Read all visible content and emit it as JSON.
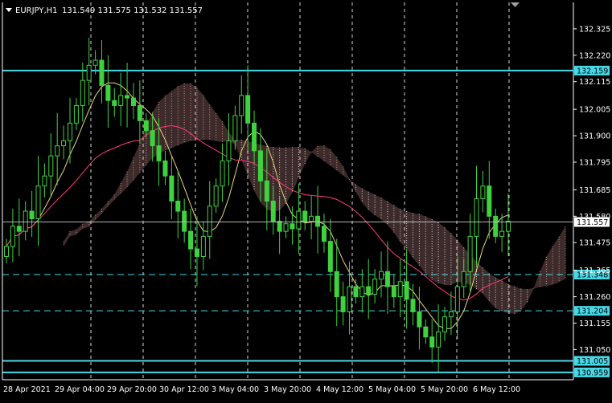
{
  "header": {
    "symbol": "EURJPY,H1",
    "ohlc": "131.549 131.575 131.532 131.557"
  },
  "colors": {
    "background": "#000000",
    "grid": "#ffffff",
    "candle": "#3fd23f",
    "hline": "#47d9e8",
    "ma_pink": "#ff3c78",
    "ma_yellow": "#e8d87a",
    "cloud_pink": "#f4a7a7",
    "cloud_white": "#ffffff",
    "axis_text": "#ffffff",
    "current_price_box": "#ffffff"
  },
  "chart_data": {
    "type": "candlestick",
    "title": "EURJPY,H1",
    "ylim": [
      130.93,
      132.43
    ],
    "y_ticks": [
      "132.325",
      "132.220",
      "132.115",
      "132.005",
      "131.900",
      "131.795",
      "131.685",
      "131.580",
      "131.475",
      "131.365",
      "131.260",
      "131.155",
      "131.050"
    ],
    "x_ticks": [
      "28 Apr 2021",
      "29 Apr 04:00",
      "29 Apr 20:00",
      "30 Apr 12:00",
      "3 May 04:00",
      "3 May 20:00",
      "4 May 12:00",
      "5 May 04:00",
      "5 May 20:00",
      "6 May 12:00"
    ],
    "current_price": "131.557",
    "horizontal_levels": [
      {
        "label": "132.159",
        "value": 132.159,
        "style": "solid"
      },
      {
        "label": "131.348",
        "value": 131.348,
        "style": "dashed"
      },
      {
        "label": "131.204",
        "value": 131.204,
        "style": "dashed"
      },
      {
        "label": "131.005",
        "value": 131.005,
        "style": "solid"
      },
      {
        "label": "130.959",
        "value": 130.959,
        "style": "solid"
      }
    ],
    "series": [
      {
        "name": "close",
        "values": [
          131.46,
          131.54,
          131.52,
          131.6,
          131.57,
          131.7,
          131.74,
          131.82,
          131.86,
          131.88,
          131.95,
          132.02,
          132.12,
          132.18,
          132.2,
          132.1,
          132.04,
          132.02,
          132.06,
          132.05,
          132.02,
          131.96,
          131.92,
          131.86,
          131.8,
          131.74,
          131.64,
          131.6,
          131.52,
          131.45,
          131.42,
          131.5,
          131.62,
          131.7,
          131.8,
          131.88,
          131.98,
          132.06,
          131.95,
          131.84,
          131.72,
          131.64,
          131.56,
          131.52,
          131.55,
          131.53,
          131.6,
          131.56,
          131.58,
          131.54,
          131.48,
          131.36,
          131.26,
          131.2,
          131.3,
          131.26,
          131.3,
          131.27,
          131.33,
          131.36,
          131.3,
          131.26,
          131.32,
          131.25,
          131.2,
          131.14,
          131.1,
          131.06,
          131.12,
          131.18,
          131.2,
          131.3,
          131.36,
          131.5,
          131.65,
          131.7,
          131.58,
          131.5,
          131.52,
          131.56
        ]
      }
    ]
  }
}
